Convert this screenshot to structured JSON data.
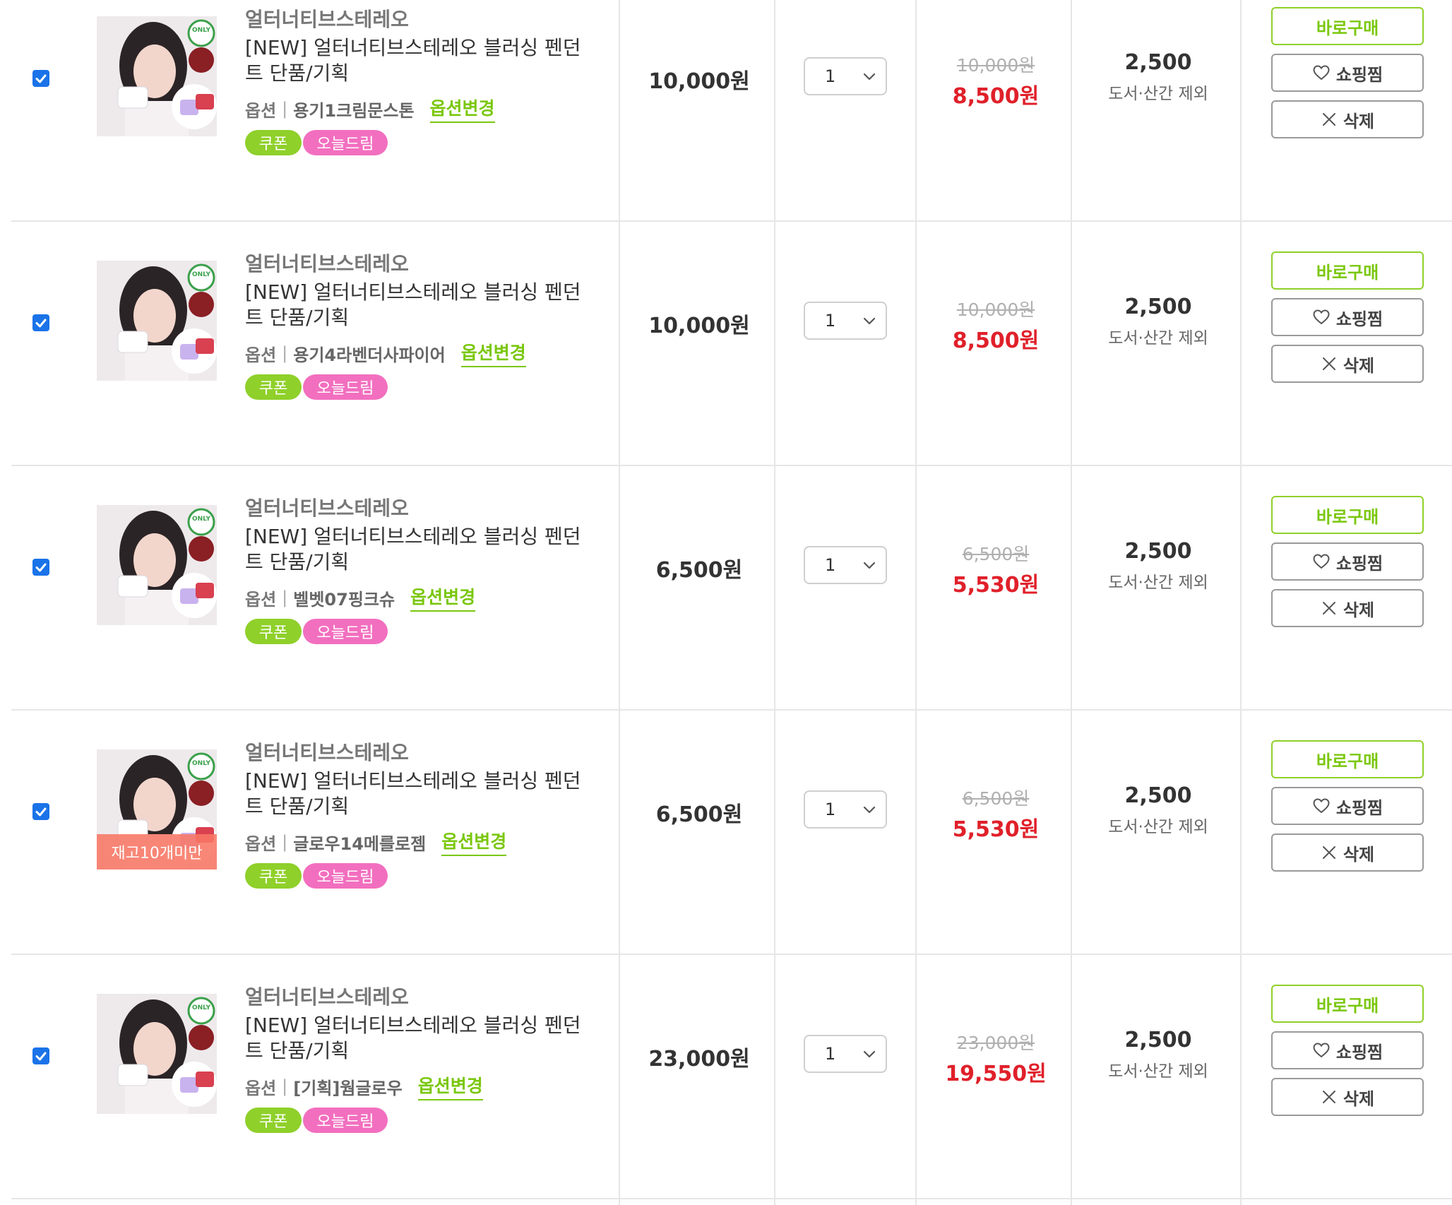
{
  "colors": {
    "accent_green": "#8fd02a",
    "coupon_green": "#8fd02a",
    "today_pink": "#f26fbf",
    "sale_red": "#e0202a",
    "checkbox_blue": "#1a73e8"
  },
  "items": [
    {
      "checked": true,
      "thumbnail": {
        "alt": "product-photo",
        "badge_only": "ONLY"
      },
      "brand": "얼터너티브스테레오",
      "name": "[NEW] 얼터너티브스테레오 블러싱 펜던트 단품/기획",
      "option_key": "옵션",
      "option_value": "용기1크림문스톤",
      "option_change": "옵션변경",
      "tags": [
        "쿠폰",
        "오늘드림"
      ],
      "price": "10,000원",
      "quantity": "1",
      "original_price": "10,000원",
      "sale_price": "8,500원",
      "shipping_fee": "2,500",
      "shipping_note": "도서·산간 제외",
      "buttons": {
        "buy": "바로구매",
        "wish": "쇼핑찜",
        "delete": "삭제"
      }
    },
    {
      "checked": true,
      "thumbnail": {
        "alt": "product-photo",
        "badge_only": "ONLY"
      },
      "brand": "얼터너티브스테레오",
      "name": "[NEW] 얼터너티브스테레오 블러싱 펜던트 단품/기획",
      "option_key": "옵션",
      "option_value": "용기4라벤더사파이어",
      "option_change": "옵션변경",
      "tags": [
        "쿠폰",
        "오늘드림"
      ],
      "price": "10,000원",
      "quantity": "1",
      "original_price": "10,000원",
      "sale_price": "8,500원",
      "shipping_fee": "2,500",
      "shipping_note": "도서·산간 제외",
      "buttons": {
        "buy": "바로구매",
        "wish": "쇼핑찜",
        "delete": "삭제"
      }
    },
    {
      "checked": true,
      "thumbnail": {
        "alt": "product-photo",
        "badge_only": "ONLY"
      },
      "brand": "얼터너티브스테레오",
      "name": "[NEW] 얼터너티브스테레오 블러싱 펜던트 단품/기획",
      "option_key": "옵션",
      "option_value": "벨벳07핑크슈",
      "option_change": "옵션변경",
      "tags": [
        "쿠폰",
        "오늘드림"
      ],
      "price": "6,500원",
      "quantity": "1",
      "original_price": "6,500원",
      "sale_price": "5,530원",
      "shipping_fee": "2,500",
      "shipping_note": "도서·산간 제외",
      "buttons": {
        "buy": "바로구매",
        "wish": "쇼핑찜",
        "delete": "삭제"
      }
    },
    {
      "checked": true,
      "thumbnail": {
        "alt": "product-photo",
        "badge_only": "ONLY",
        "stock_badge": "재고10개미만"
      },
      "brand": "얼터너티브스테레오",
      "name": "[NEW] 얼터너티브스테레오 블러싱 펜던트 단품/기획",
      "option_key": "옵션",
      "option_value": "글로우14메를로젬",
      "option_change": "옵션변경",
      "tags": [
        "쿠폰",
        "오늘드림"
      ],
      "price": "6,500원",
      "quantity": "1",
      "original_price": "6,500원",
      "sale_price": "5,530원",
      "shipping_fee": "2,500",
      "shipping_note": "도서·산간 제외",
      "buttons": {
        "buy": "바로구매",
        "wish": "쇼핑찜",
        "delete": "삭제"
      }
    },
    {
      "checked": true,
      "thumbnail": {
        "alt": "product-photo",
        "badge_only": "ONLY"
      },
      "brand": "얼터너티브스테레오",
      "name": "[NEW] 얼터너티브스테레오 블러싱 펜던트 단품/기획",
      "option_key": "옵션",
      "option_value": "[기획]웜글로우",
      "option_change": "옵션변경",
      "tags": [
        "쿠폰",
        "오늘드림"
      ],
      "price": "23,000원",
      "quantity": "1",
      "original_price": "23,000원",
      "sale_price": "19,550원",
      "shipping_fee": "2,500",
      "shipping_note": "도서·산간 제외",
      "buttons": {
        "buy": "바로구매",
        "wish": "쇼핑찜",
        "delete": "삭제"
      }
    }
  ]
}
